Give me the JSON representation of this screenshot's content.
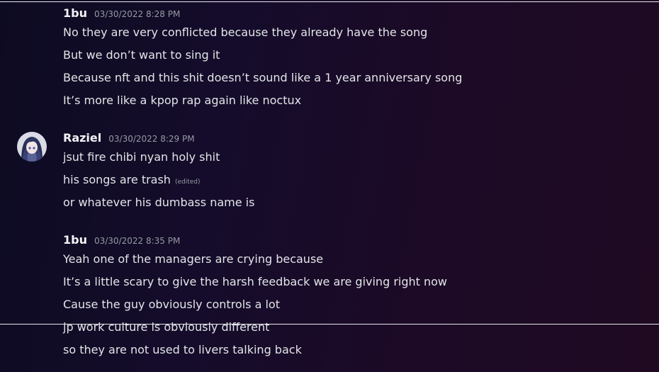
{
  "groups": [
    {
      "author": "1bu",
      "timestamp": "03/30/2022 8:28 PM",
      "messages": [
        "No they are very conflicted because they already have the song",
        "But we don’t want to sing it",
        "Because nft and this shit doesn’t sound like a 1 year anniversary song",
        "It’s more like a kpop rap again like noctux"
      ]
    },
    {
      "author": "Raziel",
      "timestamp": "03/30/2022 8:29 PM",
      "avatar": "raziel-avatar",
      "messages": [
        "jsut fire chibi nyan holy shit",
        "his songs are trash",
        "or whatever his dumbass name is"
      ],
      "edited_label": "(edited)"
    },
    {
      "author": "1bu",
      "timestamp": "03/30/2022 8:35 PM",
      "messages": [
        "Yeah one of the managers are crying because",
        "It’s a little scary to give the harsh feedback we are giving right now",
        "Cause the guy obviously controls a lot",
        "jp work culture is obviously different",
        "so they are not used to livers talking back"
      ]
    }
  ],
  "colors": {
    "background": "#150c2b",
    "text": "#e3e5e8",
    "muted": "#949ba4",
    "username": "#f2f3f5"
  }
}
